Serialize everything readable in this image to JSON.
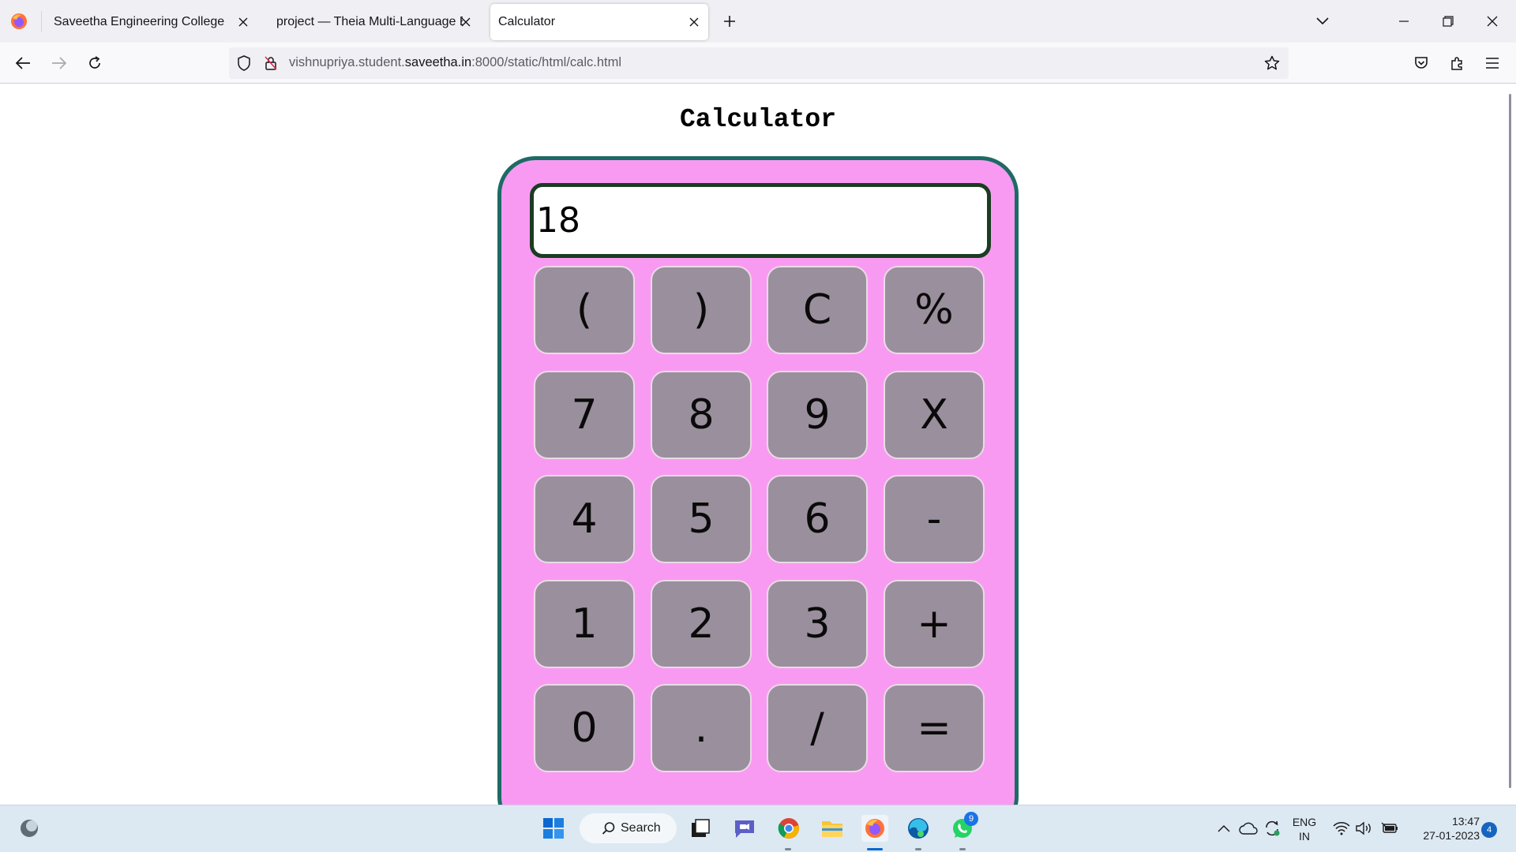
{
  "browser": {
    "tabs": [
      {
        "title": "Saveetha Engineering College"
      },
      {
        "title": "project — Theia Multi-Language Ex"
      },
      {
        "title": "Calculator"
      }
    ],
    "url": {
      "prefix": "vishnupriya.student.",
      "host": "saveetha.in",
      "suffix": ":8000/static/html/calc.html"
    }
  },
  "page": {
    "title": "Calculator",
    "display_value": "18",
    "keys": [
      "(",
      ")",
      "C",
      "%",
      "7",
      "8",
      "9",
      "X",
      "4",
      "5",
      "6",
      "-",
      "1",
      "2",
      "3",
      "+",
      "0",
      ".",
      "/",
      "="
    ]
  },
  "colors": {
    "calc_body": "#f99af2",
    "calc_border": "#1d6b64",
    "key_bg": "#9a8f9c",
    "display_border": "#1a3d22"
  },
  "taskbar": {
    "search_label": "Search",
    "whatsapp_badge": "9",
    "lang_top": "ENG",
    "lang_bottom": "IN",
    "time": "13:47",
    "date": "27-01-2023",
    "notification_count": "4"
  }
}
